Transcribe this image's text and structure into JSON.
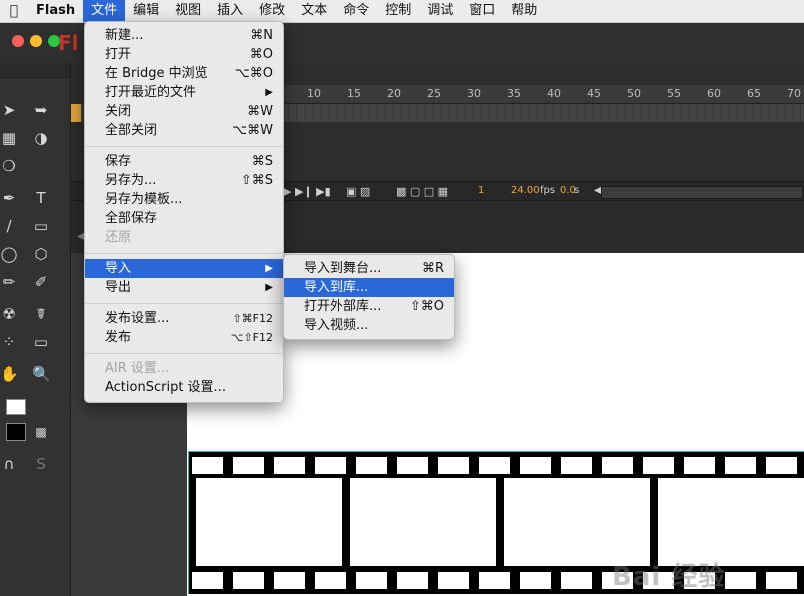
{
  "menubar": {
    "apple_icon": "apple-icon",
    "items": [
      "Flash",
      "文件",
      "编辑",
      "视图",
      "插入",
      "修改",
      "文本",
      "命令",
      "控制",
      "调试",
      "窗口",
      "帮助"
    ]
  },
  "app": {
    "logo_text": "Fl"
  },
  "timeline": {
    "ticks": [
      "10",
      "15",
      "20",
      "25",
      "30",
      "35",
      "40",
      "45",
      "50",
      "55",
      "60",
      "65",
      "70"
    ],
    "frame": "1",
    "fps": "24.00",
    "fps_unit": "fps",
    "time": "0.0",
    "time_unit": "s"
  },
  "file_menu": {
    "items": [
      {
        "label": "新建...",
        "shortcut": "⌘N"
      },
      {
        "label": "打开",
        "shortcut": "⌘O"
      },
      {
        "label": "在 Bridge 中浏览",
        "shortcut": "⌥⌘O"
      },
      {
        "label": "打开最近的文件",
        "shortcut": "▶"
      },
      {
        "label": "关闭",
        "shortcut": "⌘W"
      },
      {
        "label": "全部关闭",
        "shortcut": "⌥⌘W"
      },
      {
        "label": "保存",
        "shortcut": "⌘S"
      },
      {
        "label": "另存为...",
        "shortcut": "⇧⌘S"
      },
      {
        "label": "另存为模板...",
        "shortcut": ""
      },
      {
        "label": "全部保存",
        "shortcut": ""
      },
      {
        "label": "还原",
        "shortcut": ""
      },
      {
        "label": "导入",
        "shortcut": "▶"
      },
      {
        "label": "导出",
        "shortcut": "▶"
      },
      {
        "label": "发布设置...",
        "shortcut": "⇧⌘F12"
      },
      {
        "label": "发布",
        "shortcut": "⌥⇧F12"
      },
      {
        "label": "AIR 设置...",
        "shortcut": ""
      },
      {
        "label": "ActionScript 设置...",
        "shortcut": ""
      }
    ]
  },
  "import_menu": {
    "items": [
      {
        "label": "导入到舞台...",
        "shortcut": "⌘R"
      },
      {
        "label": "导入到库...",
        "shortcut": ""
      },
      {
        "label": "打开外部库...",
        "shortcut": "⇧⌘O"
      },
      {
        "label": "导入视频...",
        "shortcut": ""
      }
    ]
  },
  "colors": {
    "highlight": "#2a67d8",
    "logo": "#c2352c",
    "stage": "#ffffff"
  },
  "watermark": "Bai 经验"
}
